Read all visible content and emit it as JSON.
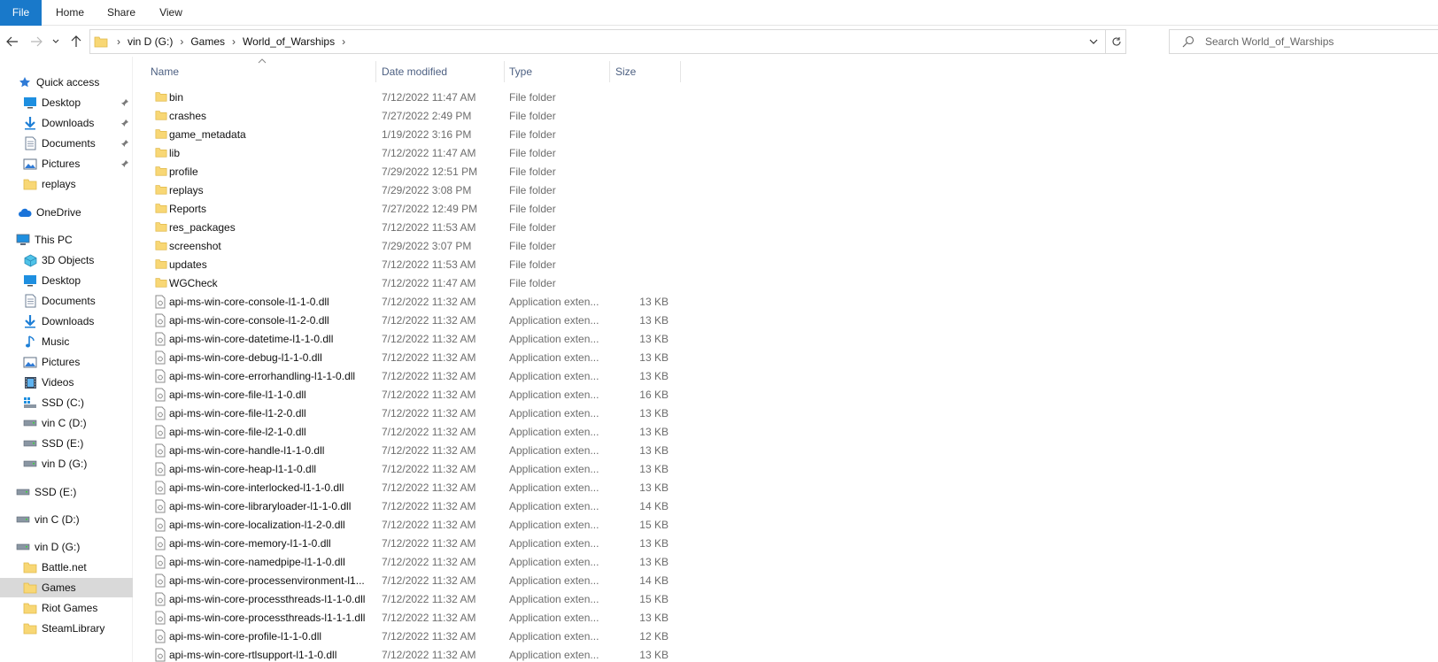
{
  "ribbon": {
    "tabs": [
      "File",
      "Home",
      "Share",
      "View"
    ]
  },
  "address": {
    "crumbs": [
      "vin D (G:)",
      "Games",
      "World_of_Warships"
    ]
  },
  "search": {
    "placeholder": "Search World_of_Warships"
  },
  "nav": {
    "quick_access": "Quick access",
    "quick_items": [
      {
        "label": "Desktop",
        "icon": "desktop-icon",
        "pinned": true
      },
      {
        "label": "Downloads",
        "icon": "downloads-icon",
        "pinned": true
      },
      {
        "label": "Documents",
        "icon": "documents-icon",
        "pinned": true
      },
      {
        "label": "Pictures",
        "icon": "pictures-icon",
        "pinned": true
      },
      {
        "label": "replays",
        "icon": "folder-icon",
        "pinned": false
      }
    ],
    "onedrive": "OneDrive",
    "this_pc": "This PC",
    "pc_items": [
      {
        "label": "3D Objects",
        "icon": "3d-objects-icon"
      },
      {
        "label": "Desktop",
        "icon": "desktop-icon"
      },
      {
        "label": "Documents",
        "icon": "documents-icon"
      },
      {
        "label": "Downloads",
        "icon": "downloads-icon"
      },
      {
        "label": "Music",
        "icon": "music-icon"
      },
      {
        "label": "Pictures",
        "icon": "pictures-icon"
      },
      {
        "label": "Videos",
        "icon": "videos-icon"
      },
      {
        "label": "SSD (C:)",
        "icon": "system-drive-icon"
      },
      {
        "label": "vin C (D:)",
        "icon": "drive-icon"
      },
      {
        "label": "SSD (E:)",
        "icon": "drive-icon"
      },
      {
        "label": "vin D (G:)",
        "icon": "drive-icon"
      }
    ],
    "drives": [
      {
        "label": "SSD (E:)"
      },
      {
        "label": "vin C (D:)"
      },
      {
        "label": "vin D (G:)"
      }
    ],
    "g_items": [
      {
        "label": "Battle.net",
        "selected": false
      },
      {
        "label": "Games",
        "selected": true
      },
      {
        "label": "Riot Games",
        "selected": false
      },
      {
        "label": "SteamLibrary",
        "selected": false
      }
    ]
  },
  "columns": {
    "name": "Name",
    "date": "Date modified",
    "type": "Type",
    "size": "Size"
  },
  "files": [
    {
      "name": "bin",
      "date": "7/12/2022 11:47 AM",
      "type": "File folder",
      "size": "",
      "kind": "folder"
    },
    {
      "name": "crashes",
      "date": "7/27/2022 2:49 PM",
      "type": "File folder",
      "size": "",
      "kind": "folder"
    },
    {
      "name": "game_metadata",
      "date": "1/19/2022 3:16 PM",
      "type": "File folder",
      "size": "",
      "kind": "folder"
    },
    {
      "name": "lib",
      "date": "7/12/2022 11:47 AM",
      "type": "File folder",
      "size": "",
      "kind": "folder"
    },
    {
      "name": "profile",
      "date": "7/29/2022 12:51 PM",
      "type": "File folder",
      "size": "",
      "kind": "folder"
    },
    {
      "name": "replays",
      "date": "7/29/2022 3:08 PM",
      "type": "File folder",
      "size": "",
      "kind": "folder"
    },
    {
      "name": "Reports",
      "date": "7/27/2022 12:49 PM",
      "type": "File folder",
      "size": "",
      "kind": "folder"
    },
    {
      "name": "res_packages",
      "date": "7/12/2022 11:53 AM",
      "type": "File folder",
      "size": "",
      "kind": "folder"
    },
    {
      "name": "screenshot",
      "date": "7/29/2022 3:07 PM",
      "type": "File folder",
      "size": "",
      "kind": "folder"
    },
    {
      "name": "updates",
      "date": "7/12/2022 11:53 AM",
      "type": "File folder",
      "size": "",
      "kind": "folder"
    },
    {
      "name": "WGCheck",
      "date": "7/12/2022 11:47 AM",
      "type": "File folder",
      "size": "",
      "kind": "folder"
    },
    {
      "name": "api-ms-win-core-console-l1-1-0.dll",
      "date": "7/12/2022 11:32 AM",
      "type": "Application exten...",
      "size": "13 KB",
      "kind": "dll"
    },
    {
      "name": "api-ms-win-core-console-l1-2-0.dll",
      "date": "7/12/2022 11:32 AM",
      "type": "Application exten...",
      "size": "13 KB",
      "kind": "dll"
    },
    {
      "name": "api-ms-win-core-datetime-l1-1-0.dll",
      "date": "7/12/2022 11:32 AM",
      "type": "Application exten...",
      "size": "13 KB",
      "kind": "dll"
    },
    {
      "name": "api-ms-win-core-debug-l1-1-0.dll",
      "date": "7/12/2022 11:32 AM",
      "type": "Application exten...",
      "size": "13 KB",
      "kind": "dll"
    },
    {
      "name": "api-ms-win-core-errorhandling-l1-1-0.dll",
      "date": "7/12/2022 11:32 AM",
      "type": "Application exten...",
      "size": "13 KB",
      "kind": "dll"
    },
    {
      "name": "api-ms-win-core-file-l1-1-0.dll",
      "date": "7/12/2022 11:32 AM",
      "type": "Application exten...",
      "size": "16 KB",
      "kind": "dll"
    },
    {
      "name": "api-ms-win-core-file-l1-2-0.dll",
      "date": "7/12/2022 11:32 AM",
      "type": "Application exten...",
      "size": "13 KB",
      "kind": "dll"
    },
    {
      "name": "api-ms-win-core-file-l2-1-0.dll",
      "date": "7/12/2022 11:32 AM",
      "type": "Application exten...",
      "size": "13 KB",
      "kind": "dll"
    },
    {
      "name": "api-ms-win-core-handle-l1-1-0.dll",
      "date": "7/12/2022 11:32 AM",
      "type": "Application exten...",
      "size": "13 KB",
      "kind": "dll"
    },
    {
      "name": "api-ms-win-core-heap-l1-1-0.dll",
      "date": "7/12/2022 11:32 AM",
      "type": "Application exten...",
      "size": "13 KB",
      "kind": "dll"
    },
    {
      "name": "api-ms-win-core-interlocked-l1-1-0.dll",
      "date": "7/12/2022 11:32 AM",
      "type": "Application exten...",
      "size": "13 KB",
      "kind": "dll"
    },
    {
      "name": "api-ms-win-core-libraryloader-l1-1-0.dll",
      "date": "7/12/2022 11:32 AM",
      "type": "Application exten...",
      "size": "14 KB",
      "kind": "dll"
    },
    {
      "name": "api-ms-win-core-localization-l1-2-0.dll",
      "date": "7/12/2022 11:32 AM",
      "type": "Application exten...",
      "size": "15 KB",
      "kind": "dll"
    },
    {
      "name": "api-ms-win-core-memory-l1-1-0.dll",
      "date": "7/12/2022 11:32 AM",
      "type": "Application exten...",
      "size": "13 KB",
      "kind": "dll"
    },
    {
      "name": "api-ms-win-core-namedpipe-l1-1-0.dll",
      "date": "7/12/2022 11:32 AM",
      "type": "Application exten...",
      "size": "13 KB",
      "kind": "dll"
    },
    {
      "name": "api-ms-win-core-processenvironment-l1...",
      "date": "7/12/2022 11:32 AM",
      "type": "Application exten...",
      "size": "14 KB",
      "kind": "dll"
    },
    {
      "name": "api-ms-win-core-processthreads-l1-1-0.dll",
      "date": "7/12/2022 11:32 AM",
      "type": "Application exten...",
      "size": "15 KB",
      "kind": "dll"
    },
    {
      "name": "api-ms-win-core-processthreads-l1-1-1.dll",
      "date": "7/12/2022 11:32 AM",
      "type": "Application exten...",
      "size": "13 KB",
      "kind": "dll"
    },
    {
      "name": "api-ms-win-core-profile-l1-1-0.dll",
      "date": "7/12/2022 11:32 AM",
      "type": "Application exten...",
      "size": "12 KB",
      "kind": "dll"
    },
    {
      "name": "api-ms-win-core-rtlsupport-l1-1-0.dll",
      "date": "7/12/2022 11:32 AM",
      "type": "Application exten...",
      "size": "13 KB",
      "kind": "dll"
    }
  ],
  "colors": {
    "file_tab": "#1979ca",
    "folder": "#f8d775",
    "header_text": "#4d6082",
    "selection": "#d9d9d9"
  }
}
